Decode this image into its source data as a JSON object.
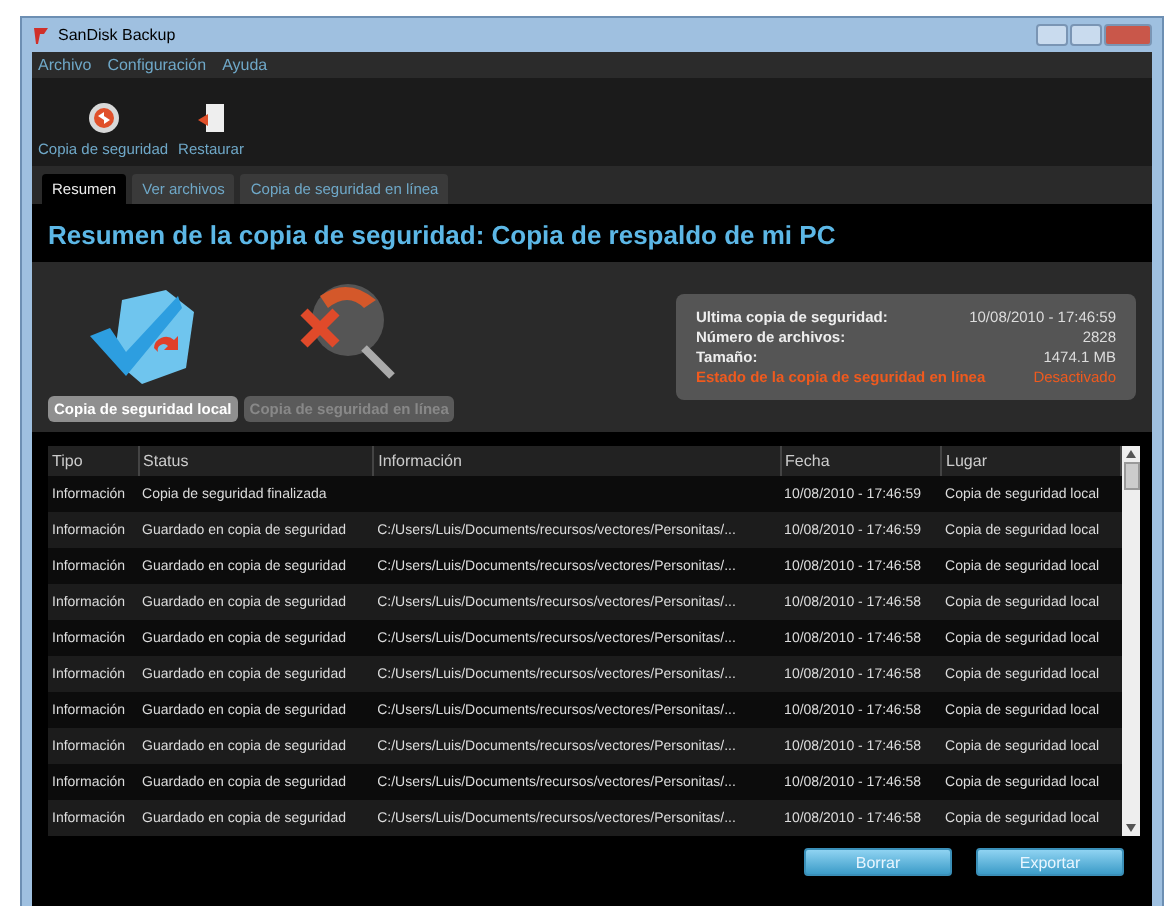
{
  "window": {
    "title": "SanDisk Backup"
  },
  "menu": [
    "Archivo",
    "Configuración",
    "Ayuda"
  ],
  "toolbar": [
    {
      "label": "Copia de seguridad",
      "kind": "backup"
    },
    {
      "label": "Restaurar",
      "kind": "restore"
    }
  ],
  "tabs": [
    {
      "label": "Resumen",
      "selected": true
    },
    {
      "label": "Ver archivos",
      "selected": false
    },
    {
      "label": "Copia de seguridad en línea",
      "selected": false
    }
  ],
  "heading": "Resumen de la copia de seguridad: Copia de respaldo de mi PC",
  "modes": [
    {
      "label": "Copia de seguridad local",
      "kind": "local",
      "selected": true
    },
    {
      "label": "Copia de seguridad en línea",
      "kind": "online",
      "selected": false
    }
  ],
  "summary": {
    "rows": [
      {
        "label": "Ultima copia de seguridad:",
        "value": "10/08/2010 - 17:46:59"
      },
      {
        "label": "Número de archivos:",
        "value": "2828"
      },
      {
        "label": "Tamaño:",
        "value": "1474.1 MB"
      }
    ],
    "online_status": {
      "label": "Estado de la copia de seguridad en línea",
      "value": "Desactivado"
    }
  },
  "table": {
    "columns": [
      "Tipo",
      "Status",
      "Información",
      "Fecha",
      "Lugar"
    ],
    "rows": [
      [
        "Información",
        "Copia de seguridad finalizada",
        "",
        "10/08/2010 - 17:46:59",
        "Copia de seguridad local"
      ],
      [
        "Información",
        "Guardado en copia de seguridad",
        "C:/Users/Luis/Documents/recursos/vectores/Personitas/...",
        "10/08/2010 - 17:46:59",
        "Copia de seguridad local"
      ],
      [
        "Información",
        "Guardado en copia de seguridad",
        "C:/Users/Luis/Documents/recursos/vectores/Personitas/...",
        "10/08/2010 - 17:46:58",
        "Copia de seguridad local"
      ],
      [
        "Información",
        "Guardado en copia de seguridad",
        "C:/Users/Luis/Documents/recursos/vectores/Personitas/...",
        "10/08/2010 - 17:46:58",
        "Copia de seguridad local"
      ],
      [
        "Información",
        "Guardado en copia de seguridad",
        "C:/Users/Luis/Documents/recursos/vectores/Personitas/...",
        "10/08/2010 - 17:46:58",
        "Copia de seguridad local"
      ],
      [
        "Información",
        "Guardado en copia de seguridad",
        "C:/Users/Luis/Documents/recursos/vectores/Personitas/...",
        "10/08/2010 - 17:46:58",
        "Copia de seguridad local"
      ],
      [
        "Información",
        "Guardado en copia de seguridad",
        "C:/Users/Luis/Documents/recursos/vectores/Personitas/...",
        "10/08/2010 - 17:46:58",
        "Copia de seguridad local"
      ],
      [
        "Información",
        "Guardado en copia de seguridad",
        "C:/Users/Luis/Documents/recursos/vectores/Personitas/...",
        "10/08/2010 - 17:46:58",
        "Copia de seguridad local"
      ],
      [
        "Información",
        "Guardado en copia de seguridad",
        "C:/Users/Luis/Documents/recursos/vectores/Personitas/...",
        "10/08/2010 - 17:46:58",
        "Copia de seguridad local"
      ],
      [
        "Información",
        "Guardado en copia de seguridad",
        "C:/Users/Luis/Documents/recursos/vectores/Personitas/...",
        "10/08/2010 - 17:46:58",
        "Copia de seguridad local"
      ]
    ]
  },
  "buttons": [
    "Borrar",
    "Exportar"
  ]
}
